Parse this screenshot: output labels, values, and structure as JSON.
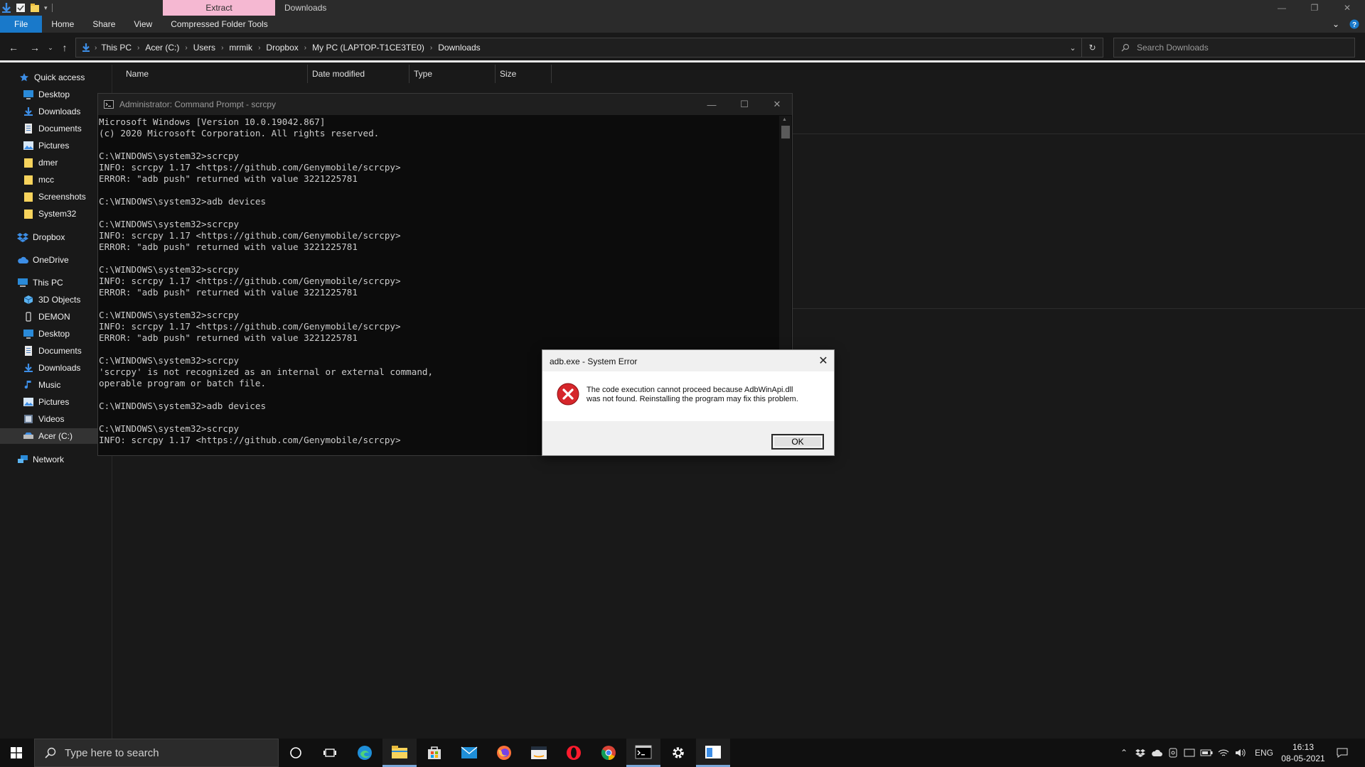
{
  "titlebar": {
    "context_tab": "Extract",
    "window_title": "Downloads"
  },
  "ribbon": {
    "file": "File",
    "home": "Home",
    "share": "Share",
    "view": "View",
    "tools": "Compressed Folder Tools"
  },
  "address": {
    "crumbs": [
      "This PC",
      "Acer (C:)",
      "Users",
      "mrmik",
      "Dropbox",
      "My PC (LAPTOP-T1CE3TE0)",
      "Downloads"
    ],
    "search_placeholder": "Search Downloads"
  },
  "nav": {
    "quick_access": "Quick access",
    "desktop": "Desktop",
    "downloads": "Downloads",
    "documents": "Documents",
    "pictures": "Pictures",
    "dmer": "dmer",
    "mcc": "mcc",
    "screenshots": "Screenshots",
    "system32": "System32",
    "dropbox": "Dropbox",
    "onedrive": "OneDrive",
    "this_pc": "This PC",
    "objects3d": "3D Objects",
    "demon": "DEMON",
    "pc_desktop": "Desktop",
    "pc_documents": "Documents",
    "pc_downloads": "Downloads",
    "music": "Music",
    "pc_pictures": "Pictures",
    "videos": "Videos",
    "acer": "Acer (C:)",
    "network": "Network"
  },
  "columns": {
    "name": "Name",
    "date": "Date modified",
    "type": "Type",
    "size": "Size"
  },
  "cmd": {
    "title": "Administrator: Command Prompt - scrcpy",
    "lines": [
      "Microsoft Windows [Version 10.0.19042.867]",
      "(c) 2020 Microsoft Corporation. All rights reserved.",
      "",
      "C:\\WINDOWS\\system32>scrcpy",
      "INFO: scrcpy 1.17 <https://github.com/Genymobile/scrcpy>",
      "ERROR: \"adb push\" returned with value 3221225781",
      "",
      "C:\\WINDOWS\\system32>adb devices",
      "",
      "C:\\WINDOWS\\system32>scrcpy",
      "INFO: scrcpy 1.17 <https://github.com/Genymobile/scrcpy>",
      "ERROR: \"adb push\" returned with value 3221225781",
      "",
      "C:\\WINDOWS\\system32>scrcpy",
      "INFO: scrcpy 1.17 <https://github.com/Genymobile/scrcpy>",
      "ERROR: \"adb push\" returned with value 3221225781",
      "",
      "C:\\WINDOWS\\system32>scrcpy",
      "INFO: scrcpy 1.17 <https://github.com/Genymobile/scrcpy>",
      "ERROR: \"adb push\" returned with value 3221225781",
      "",
      "C:\\WINDOWS\\system32>scrcpy",
      "'scrcpy' is not recognized as an internal or external command,",
      "operable program or batch file.",
      "",
      "C:\\WINDOWS\\system32>adb devices",
      "",
      "C:\\WINDOWS\\system32>scrcpy",
      "INFO: scrcpy 1.17 <https://github.com/Genymobile/scrcpy>"
    ]
  },
  "dialog": {
    "title": "adb.exe - System Error",
    "message_line1": "The code execution cannot proceed because AdbWinApi.dll",
    "message_line2": "was not found. Reinstalling the program may fix this problem.",
    "ok": "OK"
  },
  "taskbar": {
    "search_placeholder": "Type here to search",
    "language": "ENG",
    "time": "16:13",
    "date": "08-05-2021"
  },
  "colors": {
    "accent": "#1979ca",
    "context_tab": "#f5b8d2",
    "error_red": "#d6262b"
  }
}
